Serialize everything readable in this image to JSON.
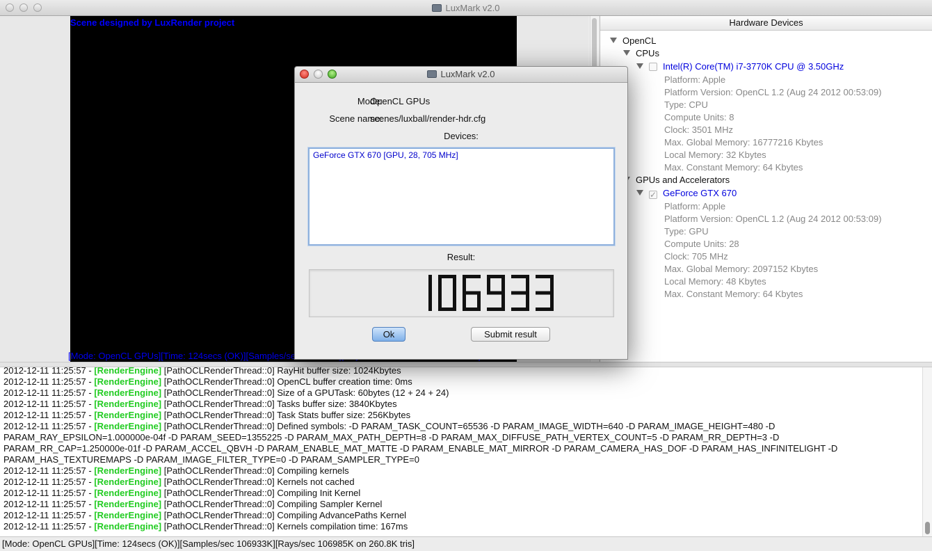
{
  "window": {
    "title": "LuxMark v2.0"
  },
  "render": {
    "scene_credit": "Scene designed by LuxRender project",
    "status_overlay": "[Mode: OpenCL GPUs][Time: 124secs (OK)][Samples/sec  106933K][Rays/sec  106985K on 260.8K tris]"
  },
  "hardware": {
    "header": "Hardware Devices",
    "root": "OpenCL",
    "cpus_label": "CPUs",
    "cpu": {
      "name": "Intel(R) Core(TM) i7-3770K CPU @ 3.50GHz",
      "checked": false,
      "props": [
        "Platform: Apple",
        "Platform Version: OpenCL 1.2 (Aug 24 2012 00:53:09)",
        "Type: CPU",
        "Compute Units: 8",
        "Clock: 3501 MHz",
        "Max. Global Memory: 16777216 Kbytes",
        "Local Memory: 32 Kbytes",
        "Max. Constant Memory: 64 Kbytes"
      ]
    },
    "gpus_label": "GPUs and Accelerators",
    "gpu": {
      "name": "GeForce GTX 670",
      "checked": true,
      "props": [
        "Platform: Apple",
        "Platform Version: OpenCL 1.2 (Aug 24 2012 00:53:09)",
        "Type: GPU",
        "Compute Units: 28",
        "Clock: 705 MHz",
        "Max. Global Memory: 2097152 Kbytes",
        "Local Memory: 48 Kbytes",
        "Max. Constant Memory: 64 Kbytes"
      ]
    }
  },
  "dialog": {
    "title": "LuxMark v2.0",
    "mode_label": "Mode:",
    "mode_value": "OpenCL GPUs",
    "scene_label": "Scene name:",
    "scene_value": "scenes/luxball/render-hdr.cfg",
    "devices_label": "Devices:",
    "devices": [
      "GeForce GTX 670 [GPU, 28, 705 MHz]"
    ],
    "result_label": "Result:",
    "result_value": "106933",
    "ok_label": "Ok",
    "submit_label": "Submit result"
  },
  "log": [
    {
      "ts": "2012-12-11 11:25:57 - ",
      "tag": "[RenderEngine]",
      "msg": " [PathOCLRenderThread::0] RayHit buffer size: 1024Kbytes"
    },
    {
      "ts": "2012-12-11 11:25:57 - ",
      "tag": "[RenderEngine]",
      "msg": " [PathOCLRenderThread::0] OpenCL buffer creation time: 0ms"
    },
    {
      "ts": "2012-12-11 11:25:57 - ",
      "tag": "[RenderEngine]",
      "msg": " [PathOCLRenderThread::0] Size of a GPUTask: 60bytes (12 + 24 + 24)"
    },
    {
      "ts": "2012-12-11 11:25:57 - ",
      "tag": "[RenderEngine]",
      "msg": " [PathOCLRenderThread::0] Tasks buffer size: 3840Kbytes"
    },
    {
      "ts": "2012-12-11 11:25:57 - ",
      "tag": "[RenderEngine]",
      "msg": " [PathOCLRenderThread::0] Task Stats buffer size: 256Kbytes"
    },
    {
      "ts": "2012-12-11 11:25:57 - ",
      "tag": "[RenderEngine]",
      "msg": " [PathOCLRenderThread::0] Defined symbols: -D PARAM_TASK_COUNT=65536 -D PARAM_IMAGE_WIDTH=640 -D PARAM_IMAGE_HEIGHT=480 -D"
    },
    {
      "ts": "",
      "tag": "",
      "msg": "PARAM_RAY_EPSILON=1.000000e-04f -D PARAM_SEED=1355225 -D PARAM_MAX_PATH_DEPTH=8 -D PARAM_MAX_DIFFUSE_PATH_VERTEX_COUNT=5 -D PARAM_RR_DEPTH=3 -D"
    },
    {
      "ts": "",
      "tag": "",
      "msg": "PARAM_RR_CAP=1.250000e-01f -D PARAM_ACCEL_QBVH -D PARAM_ENABLE_MAT_MATTE -D PARAM_ENABLE_MAT_MIRROR -D PARAM_CAMERA_HAS_DOF -D PARAM_HAS_INFINITELIGHT -D"
    },
    {
      "ts": "",
      "tag": "",
      "msg": "PARAM_HAS_TEXTUREMAPS -D PARAM_IMAGE_FILTER_TYPE=0 -D PARAM_SAMPLER_TYPE=0"
    },
    {
      "ts": "2012-12-11 11:25:57 - ",
      "tag": "[RenderEngine]",
      "msg": " [PathOCLRenderThread::0] Compiling kernels"
    },
    {
      "ts": "2012-12-11 11:25:57 - ",
      "tag": "[RenderEngine]",
      "msg": " [PathOCLRenderThread::0] Kernels not cached"
    },
    {
      "ts": "2012-12-11 11:25:57 - ",
      "tag": "[RenderEngine]",
      "msg": " [PathOCLRenderThread::0] Compiling Init Kernel"
    },
    {
      "ts": "2012-12-11 11:25:57 - ",
      "tag": "[RenderEngine]",
      "msg": " [PathOCLRenderThread::0] Compiling Sampler Kernel"
    },
    {
      "ts": "2012-12-11 11:25:57 - ",
      "tag": "[RenderEngine]",
      "msg": " [PathOCLRenderThread::0] Compiling AdvancePaths Kernel"
    },
    {
      "ts": "2012-12-11 11:25:57 - ",
      "tag": "[RenderEngine]",
      "msg": " [PathOCLRenderThread::0] Kernels compilation time: 167ms"
    }
  ],
  "statusbar": "[Mode: OpenCL GPUs][Time: 124secs (OK)][Samples/sec  106933K][Rays/sec  106985K on 260.8K tris]",
  "colors": {
    "log_tag": "#22cc22",
    "device_name": "#0000dd",
    "scene_credit": "#0000ff"
  }
}
